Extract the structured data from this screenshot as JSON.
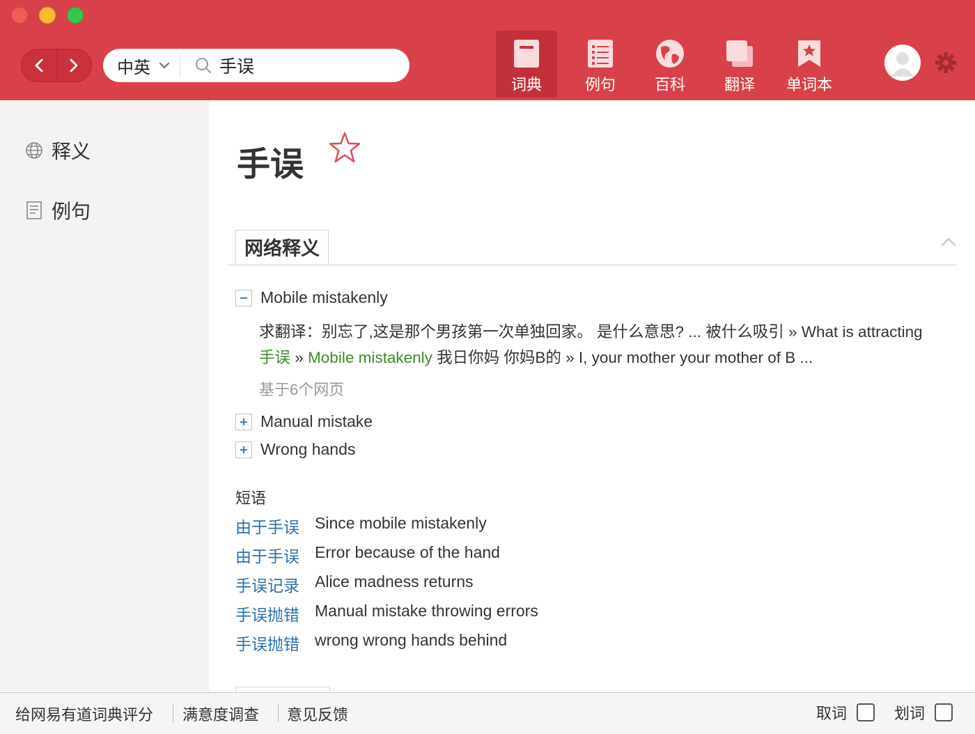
{
  "toolbar": {
    "lang": "中英",
    "query": "手误",
    "tabs": [
      {
        "label": "词典",
        "icon": "dictionary-icon",
        "active": true
      },
      {
        "label": "例句",
        "icon": "list-icon",
        "active": false
      },
      {
        "label": "百科",
        "icon": "globe-icon",
        "active": false
      },
      {
        "label": "翻译",
        "icon": "translate-icon",
        "active": false
      },
      {
        "label": "单词本",
        "icon": "wordbook-icon",
        "active": false
      }
    ]
  },
  "sidebar": {
    "items": [
      {
        "label": "释义",
        "icon": "globe-icon"
      },
      {
        "label": "例句",
        "icon": "document-icon"
      }
    ]
  },
  "main": {
    "headword": "手误",
    "section_tab": "网络释义",
    "entries": [
      {
        "sign": "−",
        "text": "Mobile mistakenly",
        "detail": {
          "part1": "求翻译：别忘了,这是那个男孩第一次单独回家。 是什么意思? ... 被什么吸引 » What is attracting ",
          "hl1": "手误",
          "part2": " » ",
          "hl2": "Mobile mistakenly",
          "part3": " 我日你妈 你妈B的 » I, your mother your mother of B ..."
        },
        "source": "基于6个网页"
      },
      {
        "sign": "+",
        "text": "Manual mistake"
      },
      {
        "sign": "+",
        "text": "Wrong hands"
      }
    ],
    "phrases_title": "短语",
    "phrases": [
      {
        "zh": "由于手误",
        "en": "Since mobile mistakenly"
      },
      {
        "zh": "由于手误",
        "en": "Error because of the hand"
      },
      {
        "zh": "手误记录",
        "en": "Alice madness returns"
      },
      {
        "zh": "手误抛错",
        "en": "Manual mistake throwing errors"
      },
      {
        "zh": "手误抛错",
        "en": "wrong wrong hands behind"
      }
    ]
  },
  "footer": {
    "links": [
      "给网易有道词典评分",
      "满意度调查",
      "意见反馈"
    ],
    "checkboxes": [
      {
        "label": "取词",
        "checked": false
      },
      {
        "label": "划词",
        "checked": false
      }
    ]
  },
  "colors": {
    "brand_red": "#d9414a",
    "active_tab": "#c2313a",
    "link_blue": "#2d6fae",
    "highlight_green": "#3d8a2f"
  }
}
